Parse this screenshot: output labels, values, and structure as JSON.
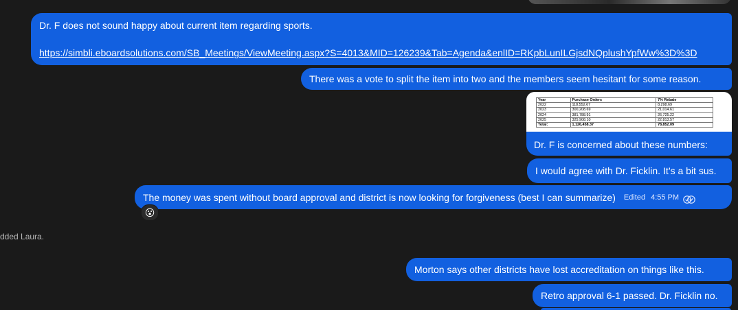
{
  "messages": {
    "m1_line1": "Dr. F does not sound happy about current item regarding sports.",
    "m1_link": "https://simbli.eboardsolutions.com/SB_Meetings/ViewMeeting.aspx?S=4013&MID=126239&Tab=Agenda&enlID=RKpbLunILGjsdNQplushYpfWw%3D%3D",
    "m2": "There was a vote to split the item into two and the members seem hesitant for some reason.",
    "m3_caption": "Dr. F is concerned about these numbers:",
    "m4": "I would agree with Dr. Ficklin. It’s a bit sus.",
    "m5": "The money was spent without board approval and district is now looking for forgiveness (best I can summarize)",
    "m5_edited": "Edited",
    "m5_time": "4:55 PM",
    "m5_reaction": "😮",
    "system_note": "dded Laura.",
    "m6": "Morton says other districts have lost accreditation on things like this.",
    "m7": "Retro approval 6-1 passed. Dr. Ficklin no."
  },
  "attached_table": {
    "headers": [
      "Year",
      "Purchase Orders",
      "7% Rebate"
    ],
    "rows": [
      [
        "2022",
        "118,552.67",
        "8,298.69"
      ],
      [
        "2023",
        "300,208.69",
        "21,014.61"
      ],
      [
        "2024",
        "381,788.91",
        "26,725.22"
      ],
      [
        "2025",
        "325,908.10",
        "22,813.57"
      ]
    ],
    "total": [
      "Total:",
      "1,126,458.37",
      "78,852.09"
    ]
  },
  "colors": {
    "background": "#1a1a1a",
    "bubble": "#1260e0"
  },
  "icons": {
    "read_receipt": "double-check-icon"
  }
}
